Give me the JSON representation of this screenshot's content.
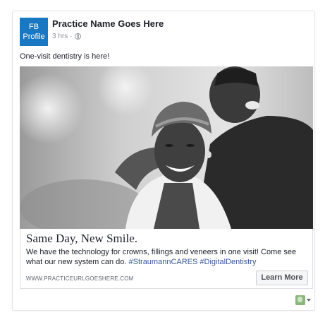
{
  "post": {
    "avatar_line1": "FB",
    "avatar_line2": "Profile",
    "page_name": "Practice Name Goes Here",
    "timestamp": "3 hrs",
    "separator": "·",
    "text": "One-visit dentistry is here!"
  },
  "ad": {
    "image_icon": "smiling-couple-photo",
    "headline": "Same Day, New Smile.",
    "description": "We have the technology for crowns, fillings and veneers in one visit! Come see what our new system can do. ",
    "hashtags": "#StraumannCARES #DigitalDentistry",
    "url": "WWW.PRACTICEURLGOESHERE.COM",
    "cta_label": "Learn More"
  },
  "footer": {
    "icon": "profile-selector-icon"
  },
  "colors": {
    "avatar_bg": "#1a78c2",
    "hashtag": "#365899",
    "text": "#1d2129",
    "muted": "#90949c"
  }
}
